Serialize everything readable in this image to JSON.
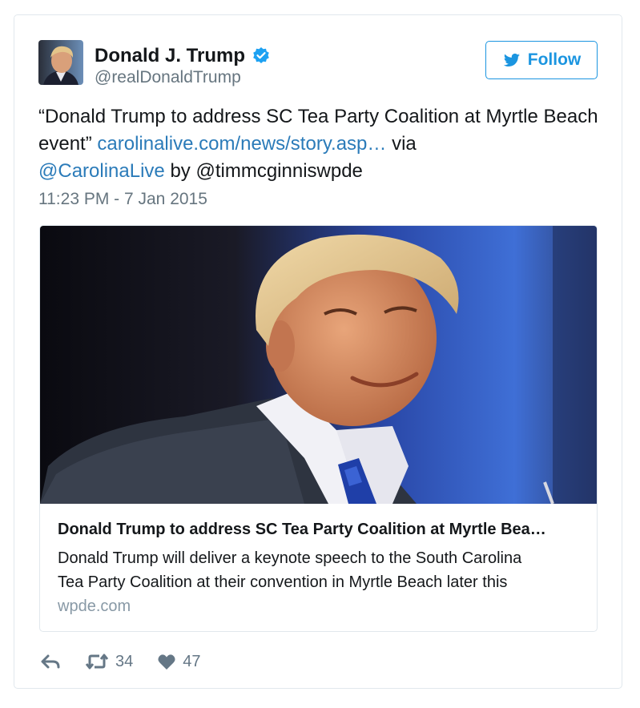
{
  "author": {
    "name": "Donald J. Trump",
    "handle": "@realDonaldTrump"
  },
  "follow_button": {
    "label": "Follow"
  },
  "tweet": {
    "text_open_quote": "“Donald Trump to address SC Tea Party Coalition at Myrtle Beach event”",
    "link_text": "carolinalive.com/news/story.asp…",
    "via_text": "via",
    "mention": "@CarolinaLive",
    "by_text": "by @timmcginniswpde",
    "timestamp": "11:23 PM - 7 Jan 2015"
  },
  "card": {
    "title": "Donald Trump to address SC Tea Party Coalition at Myrtle Bea…",
    "description_line1": "Donald Trump will deliver a keynote speech to the South Carolina",
    "description_line2": "Tea Party Coalition at their convention in Myrtle Beach later this",
    "domain": "wpde.com"
  },
  "actions": {
    "reply_icon": "reply-icon",
    "retweet_icon": "retweet-icon",
    "retweet_count": "34",
    "like_icon": "heart-icon",
    "like_count": "47"
  },
  "colors": {
    "link": "#2b7bb9",
    "follow_blue": "#1b95e0",
    "verified_blue": "#1da1f2",
    "muted": "#66757f"
  }
}
